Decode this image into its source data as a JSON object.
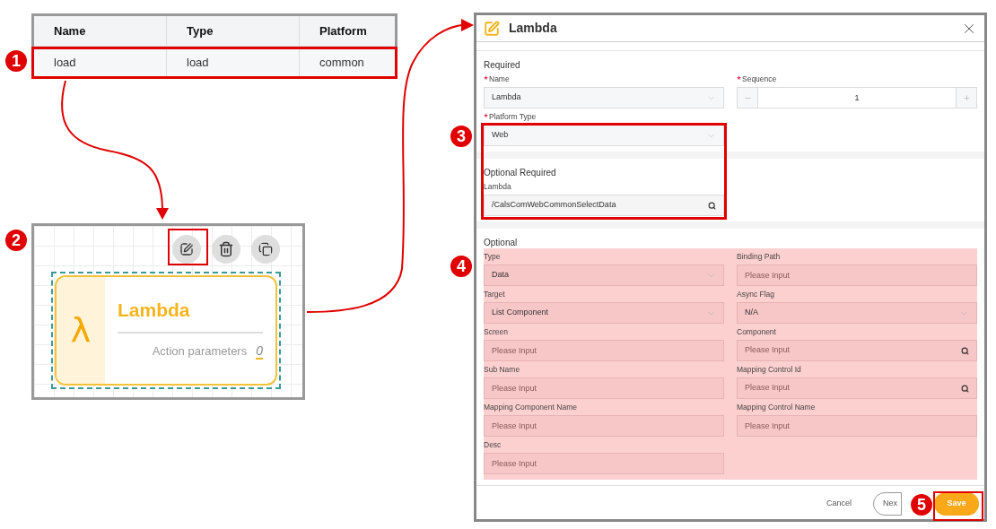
{
  "table": {
    "columns": [
      "Name",
      "Type",
      "Platform"
    ],
    "rows": [
      {
        "cells": [
          "load",
          "load",
          "common"
        ],
        "selected": true
      }
    ]
  },
  "node": {
    "symbol": "λ",
    "title": "Lambda",
    "param_label": "Action parameters",
    "param_count": "0",
    "selected": true
  },
  "dialog": {
    "title": "Lambda",
    "sections": [
      {
        "title": "Required",
        "highlighted": false,
        "fields": [
          {
            "label": "Name",
            "required": true,
            "kind": "select",
            "value": "Lambda"
          },
          {
            "label": "Sequence",
            "required": true,
            "kind": "stepper",
            "value": "1"
          },
          {
            "label": "Platform Type",
            "required": true,
            "kind": "select",
            "value": "Web"
          }
        ]
      },
      {
        "title": "Optional Required",
        "highlighted": false,
        "fields": [
          {
            "label": "Lambda",
            "required": false,
            "kind": "search",
            "value": "/CalsComWebCommonSelectData"
          }
        ]
      },
      {
        "title": "Optional",
        "highlighted": true,
        "fields": [
          {
            "label": "Type",
            "required": false,
            "kind": "select",
            "value": "Data"
          },
          {
            "label": "Binding Path",
            "required": false,
            "kind": "input",
            "placeholder": "Please Input"
          },
          {
            "label": "Target",
            "required": false,
            "kind": "select",
            "value": "List Component"
          },
          {
            "label": "Async Flag",
            "required": false,
            "kind": "select",
            "value": "N/A"
          },
          {
            "label": "Screen",
            "required": false,
            "kind": "input",
            "placeholder": "Please Input"
          },
          {
            "label": "Component",
            "required": false,
            "kind": "search",
            "placeholder": "Please Input"
          },
          {
            "label": "Sub Name",
            "required": false,
            "kind": "input",
            "placeholder": "Please Input"
          },
          {
            "label": "Mapping Control Id",
            "required": false,
            "kind": "search",
            "placeholder": "Please Input"
          },
          {
            "label": "Mapping Component Name",
            "required": false,
            "kind": "input",
            "placeholder": "Please Input"
          },
          {
            "label": "Mapping Control Name",
            "required": false,
            "kind": "input",
            "placeholder": "Please Input"
          },
          {
            "label": "Desc",
            "required": false,
            "kind": "input",
            "placeholder": "Please Input"
          }
        ]
      }
    ],
    "buttons": [
      {
        "label": "Cancel",
        "kind": "text"
      },
      {
        "label": "Nex",
        "kind": "outline"
      },
      {
        "label": "Save",
        "kind": "primary"
      }
    ]
  },
  "steps": [
    "1",
    "2",
    "3",
    "4",
    "5"
  ]
}
